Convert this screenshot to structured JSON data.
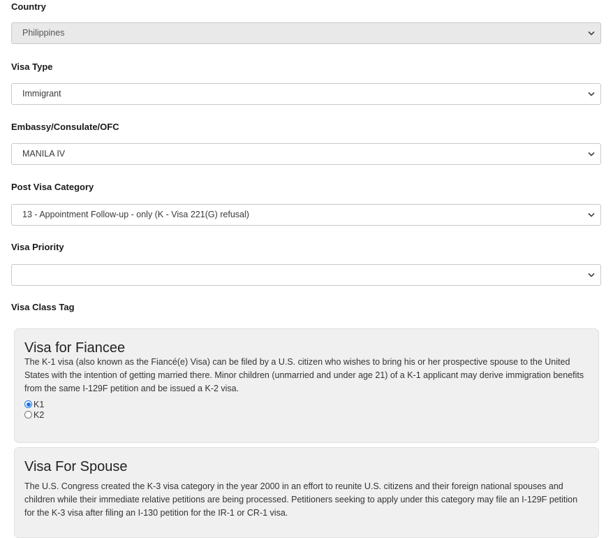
{
  "fields": [
    {
      "label": "Country",
      "value": "Philippines",
      "disabled": true
    },
    {
      "label": "Visa Type",
      "value": "Immigrant"
    },
    {
      "label": "Embassy/Consulate/OFC",
      "value": "MANILA IV"
    },
    {
      "label": "Post Visa Category",
      "value": "13 - Appointment Follow-up - only (K - Visa 221(G) refusal)"
    },
    {
      "label": "Visa Priority",
      "value": ""
    }
  ],
  "visa_class_tag": {
    "label": "Visa Class Tag"
  },
  "cards": [
    {
      "title": "Visa for Fiancee",
      "description": "The K-1 visa (also known as the Fiancé(e) Visa) can be filed by a U.S. citizen who wishes to bring his or her prospective spouse to the United States with the intention of getting married there. Minor children (unmarried and under age 21) of a K-1 applicant may derive immigration benefits from the same I-129F petition and be issued a K-2 visa.",
      "options": [
        {
          "label": "K1",
          "checked": true
        },
        {
          "label": "K2",
          "checked": false
        }
      ]
    },
    {
      "title": "Visa For Spouse",
      "description": "The U.S. Congress created the K-3 visa category in the year 2000 in an effort to reunite U.S. citizens and their foreign national spouses and children while their immediate relative petitions are being processed. Petitioners seeking to apply under this category may file an I-129F petition for the K-3 visa after filing an I-130 petition for the IR-1 or CR-1 visa."
    }
  ]
}
